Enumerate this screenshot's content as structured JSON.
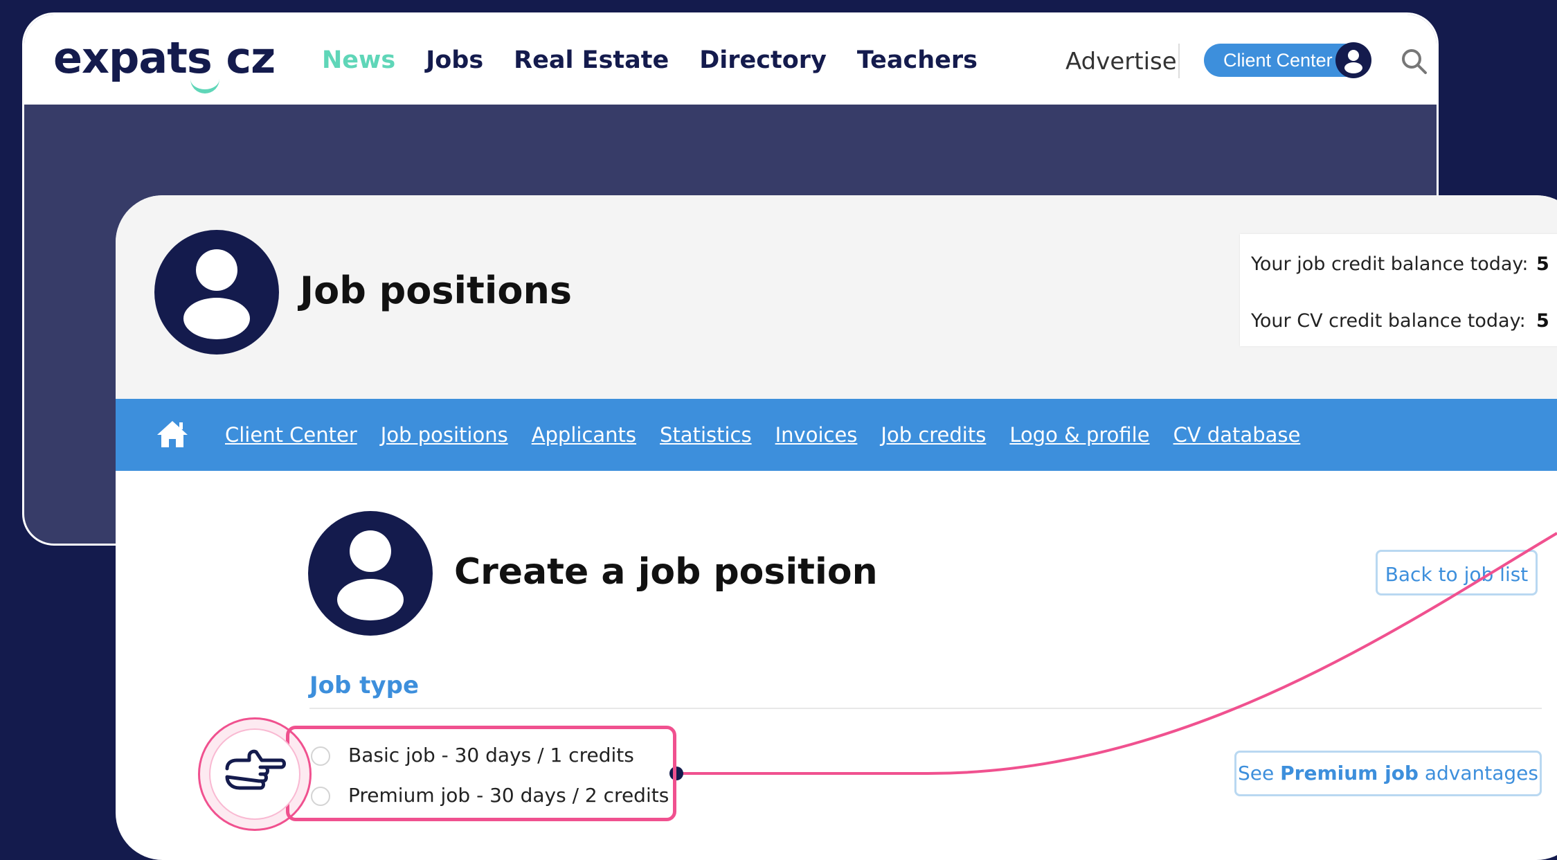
{
  "site": {
    "logo_text": "expats",
    "logo_suffix": "cz",
    "nav": [
      "News",
      "Jobs",
      "Real Estate",
      "Directory",
      "Teachers"
    ],
    "active_nav": "News",
    "advertise": "Advertise",
    "client_center_button": "Client Center"
  },
  "client_page": {
    "title": "Job positions",
    "balances": [
      {
        "label": "Your job credit balance today:",
        "value": "5"
      },
      {
        "label": "Your CV credit balance today:",
        "value": "5"
      }
    ],
    "subnav": [
      "Client Center",
      "Job positions",
      "Applicants",
      "Statistics",
      "Invoices",
      "Job credits",
      "Logo & profile",
      "CV database"
    ]
  },
  "create": {
    "title": "Create a job position",
    "back_button": "Back to job list",
    "job_type_label": "Job type",
    "options": [
      "Basic job - 30 days / 1 credits",
      "Premium job - 30 days / 2 credits"
    ],
    "premium_button_prefix": "See ",
    "premium_button_bold": "Premium job",
    "premium_button_suffix": " advantages"
  },
  "colors": {
    "background": "#141b4d",
    "accent_blue": "#3d8fdc",
    "accent_mint": "#5fd6b8",
    "highlight_pink": "#f0518f"
  }
}
